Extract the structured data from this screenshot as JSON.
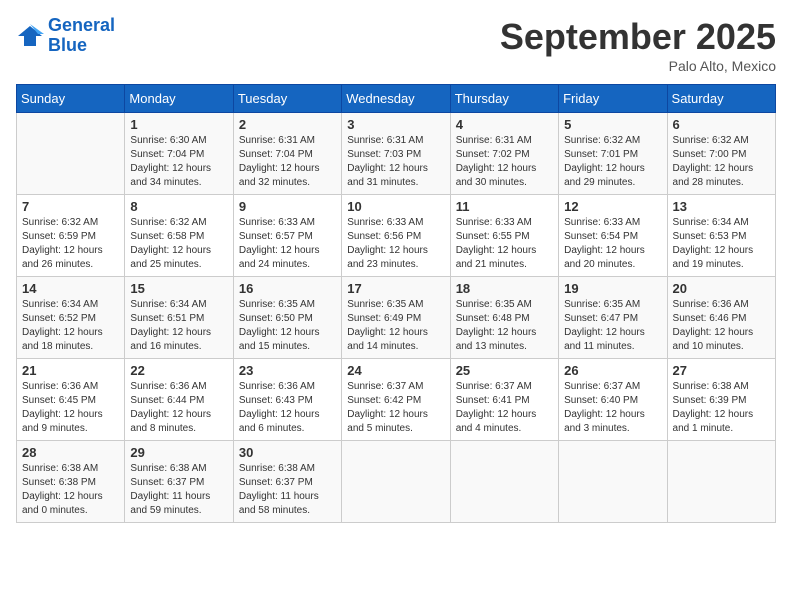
{
  "header": {
    "logo_line1": "General",
    "logo_line2": "Blue",
    "month": "September 2025",
    "location": "Palo Alto, Mexico"
  },
  "weekdays": [
    "Sunday",
    "Monday",
    "Tuesday",
    "Wednesday",
    "Thursday",
    "Friday",
    "Saturday"
  ],
  "weeks": [
    [
      {
        "day": "",
        "info": ""
      },
      {
        "day": "1",
        "info": "Sunrise: 6:30 AM\nSunset: 7:04 PM\nDaylight: 12 hours\nand 34 minutes."
      },
      {
        "day": "2",
        "info": "Sunrise: 6:31 AM\nSunset: 7:04 PM\nDaylight: 12 hours\nand 32 minutes."
      },
      {
        "day": "3",
        "info": "Sunrise: 6:31 AM\nSunset: 7:03 PM\nDaylight: 12 hours\nand 31 minutes."
      },
      {
        "day": "4",
        "info": "Sunrise: 6:31 AM\nSunset: 7:02 PM\nDaylight: 12 hours\nand 30 minutes."
      },
      {
        "day": "5",
        "info": "Sunrise: 6:32 AM\nSunset: 7:01 PM\nDaylight: 12 hours\nand 29 minutes."
      },
      {
        "day": "6",
        "info": "Sunrise: 6:32 AM\nSunset: 7:00 PM\nDaylight: 12 hours\nand 28 minutes."
      }
    ],
    [
      {
        "day": "7",
        "info": "Sunrise: 6:32 AM\nSunset: 6:59 PM\nDaylight: 12 hours\nand 26 minutes."
      },
      {
        "day": "8",
        "info": "Sunrise: 6:32 AM\nSunset: 6:58 PM\nDaylight: 12 hours\nand 25 minutes."
      },
      {
        "day": "9",
        "info": "Sunrise: 6:33 AM\nSunset: 6:57 PM\nDaylight: 12 hours\nand 24 minutes."
      },
      {
        "day": "10",
        "info": "Sunrise: 6:33 AM\nSunset: 6:56 PM\nDaylight: 12 hours\nand 23 minutes."
      },
      {
        "day": "11",
        "info": "Sunrise: 6:33 AM\nSunset: 6:55 PM\nDaylight: 12 hours\nand 21 minutes."
      },
      {
        "day": "12",
        "info": "Sunrise: 6:33 AM\nSunset: 6:54 PM\nDaylight: 12 hours\nand 20 minutes."
      },
      {
        "day": "13",
        "info": "Sunrise: 6:34 AM\nSunset: 6:53 PM\nDaylight: 12 hours\nand 19 minutes."
      }
    ],
    [
      {
        "day": "14",
        "info": "Sunrise: 6:34 AM\nSunset: 6:52 PM\nDaylight: 12 hours\nand 18 minutes."
      },
      {
        "day": "15",
        "info": "Sunrise: 6:34 AM\nSunset: 6:51 PM\nDaylight: 12 hours\nand 16 minutes."
      },
      {
        "day": "16",
        "info": "Sunrise: 6:35 AM\nSunset: 6:50 PM\nDaylight: 12 hours\nand 15 minutes."
      },
      {
        "day": "17",
        "info": "Sunrise: 6:35 AM\nSunset: 6:49 PM\nDaylight: 12 hours\nand 14 minutes."
      },
      {
        "day": "18",
        "info": "Sunrise: 6:35 AM\nSunset: 6:48 PM\nDaylight: 12 hours\nand 13 minutes."
      },
      {
        "day": "19",
        "info": "Sunrise: 6:35 AM\nSunset: 6:47 PM\nDaylight: 12 hours\nand 11 minutes."
      },
      {
        "day": "20",
        "info": "Sunrise: 6:36 AM\nSunset: 6:46 PM\nDaylight: 12 hours\nand 10 minutes."
      }
    ],
    [
      {
        "day": "21",
        "info": "Sunrise: 6:36 AM\nSunset: 6:45 PM\nDaylight: 12 hours\nand 9 minutes."
      },
      {
        "day": "22",
        "info": "Sunrise: 6:36 AM\nSunset: 6:44 PM\nDaylight: 12 hours\nand 8 minutes."
      },
      {
        "day": "23",
        "info": "Sunrise: 6:36 AM\nSunset: 6:43 PM\nDaylight: 12 hours\nand 6 minutes."
      },
      {
        "day": "24",
        "info": "Sunrise: 6:37 AM\nSunset: 6:42 PM\nDaylight: 12 hours\nand 5 minutes."
      },
      {
        "day": "25",
        "info": "Sunrise: 6:37 AM\nSunset: 6:41 PM\nDaylight: 12 hours\nand 4 minutes."
      },
      {
        "day": "26",
        "info": "Sunrise: 6:37 AM\nSunset: 6:40 PM\nDaylight: 12 hours\nand 3 minutes."
      },
      {
        "day": "27",
        "info": "Sunrise: 6:38 AM\nSunset: 6:39 PM\nDaylight: 12 hours\nand 1 minute."
      }
    ],
    [
      {
        "day": "28",
        "info": "Sunrise: 6:38 AM\nSunset: 6:38 PM\nDaylight: 12 hours\nand 0 minutes."
      },
      {
        "day": "29",
        "info": "Sunrise: 6:38 AM\nSunset: 6:37 PM\nDaylight: 11 hours\nand 59 minutes."
      },
      {
        "day": "30",
        "info": "Sunrise: 6:38 AM\nSunset: 6:37 PM\nDaylight: 11 hours\nand 58 minutes."
      },
      {
        "day": "",
        "info": ""
      },
      {
        "day": "",
        "info": ""
      },
      {
        "day": "",
        "info": ""
      },
      {
        "day": "",
        "info": ""
      }
    ]
  ]
}
